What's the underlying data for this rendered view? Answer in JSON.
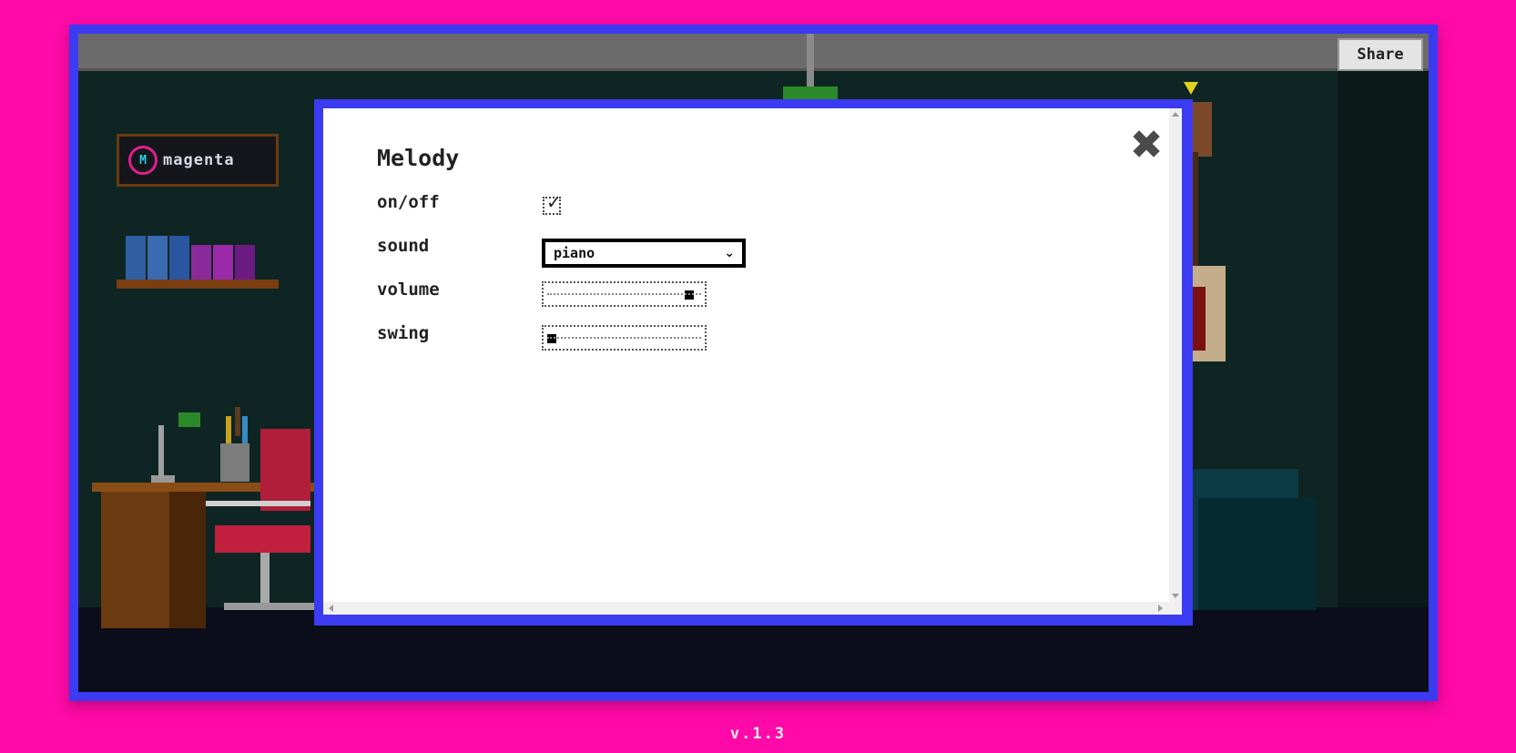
{
  "header": {
    "share_label": "Share"
  },
  "room": {
    "sign_text": "magenta",
    "logo_glyph": "M"
  },
  "melody_panel": {
    "title": "Melody",
    "rows": [
      {
        "label": "on/off",
        "control": "checkbox",
        "checked": true
      },
      {
        "label": "sound",
        "control": "select",
        "value": "piano"
      },
      {
        "label": "volume",
        "control": "slider",
        "value_fraction": 0.95
      },
      {
        "label": "swing",
        "control": "slider",
        "value_fraction": 0.0
      }
    ],
    "close_glyph": "✖",
    "check_glyph": "✓",
    "select_chevron": "⌄"
  },
  "footer": {
    "version": "v.1.3"
  },
  "colors": {
    "background": "#ff0aa8",
    "frame": "#3b3bf2",
    "panel_bg": "#ffffff",
    "text": "#222222"
  }
}
